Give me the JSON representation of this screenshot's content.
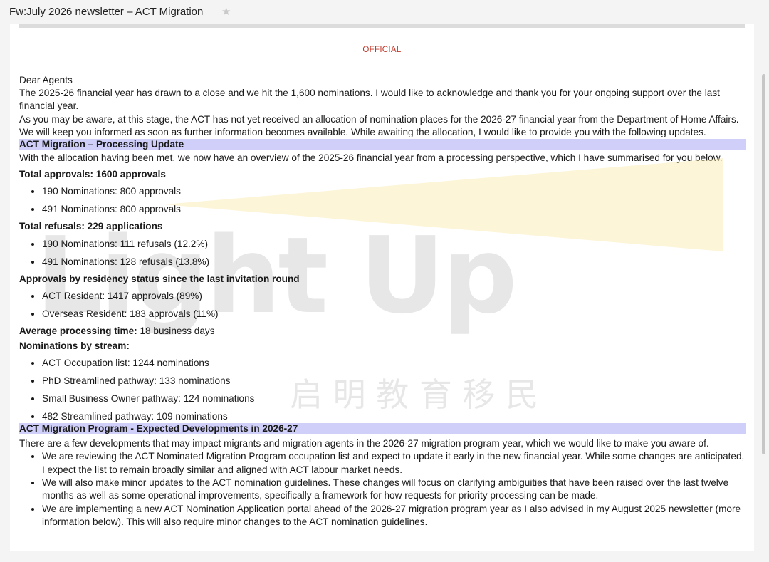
{
  "window": {
    "subject": "Fw:July 2026 newsletter – ACT Migration",
    "star_icon": "star-icon"
  },
  "email": {
    "classification": "OFFICIAL",
    "greeting": "Dear Agents",
    "para1": "The 2025-26 financial year has drawn to a close and we hit the 1,600 nominations. I would like to acknowledge and thank you for your ongoing support over the last financial year.",
    "para2": "As you may be aware, at this stage, the ACT has not yet received an allocation of nomination places for the 2026-27 financial year from the Department of Home Affairs. We will keep you informed as soon as further information becomes available. While awaiting the allocation, I would like to provide you with the following updates.",
    "section1": {
      "heading": "ACT Migration – Processing Update",
      "intro": "With the allocation having been met, we now have an overview of the 2025-26 financial year from a processing perspective, which I have summarised for you below.",
      "approvals_heading": "Total approvals: 1600 approvals",
      "approvals": [
        "190 Nominations: 800 approvals",
        "491 Nominations: 800 approvals"
      ],
      "refusals_heading": "Total refusals: 229 applications",
      "refusals": [
        "190 Nominations: 111 refusals (12.2%)",
        "491 Nominations: 128 refusals (13.8%)"
      ],
      "residency_heading": "Approvals by residency status since the last invitation round",
      "residency": [
        "ACT Resident: 1417 approvals (89%)",
        "Overseas Resident: 183 approvals (11%)"
      ],
      "processing_label": "Average processing time:",
      "processing_value": "18 business days",
      "stream_heading": "Nominations by stream:",
      "streams": [
        "ACT Occupation list: 1244 nominations",
        "PhD Streamlined pathway: 133 nominations",
        "Small Business Owner pathway: 124 nominations",
        "482 Streamlined pathway: 109 nominations"
      ]
    },
    "section2": {
      "heading": "ACT Migration Program - Expected Developments in 2026-27",
      "intro": "There are a few developments that may impact migrants and migration agents in the 2026-27 migration program year, which we would like to make you aware of.",
      "items": [
        "We are reviewing the ACT Nominated Migration Program occupation list and expect to update it early in the new financial year. While some changes are anticipated, I expect the list to remain broadly similar and aligned with ACT labour market needs.",
        "We will also make minor updates to the ACT nomination guidelines. These changes will focus on clarifying ambiguities that have been raised over the last twelve months as well as some operational improvements, specifically a framework for how requests for priority processing can be made.",
        "We are implementing a new ACT Nomination Application portal ahead of the 2026-27 migration program year as I also advised in my August 2025 newsletter (more information below). This will also require minor changes to the ACT nomination guidelines."
      ]
    }
  },
  "watermark": {
    "text": "Light Up",
    "subtext": "启 明 教 育 移 民"
  }
}
